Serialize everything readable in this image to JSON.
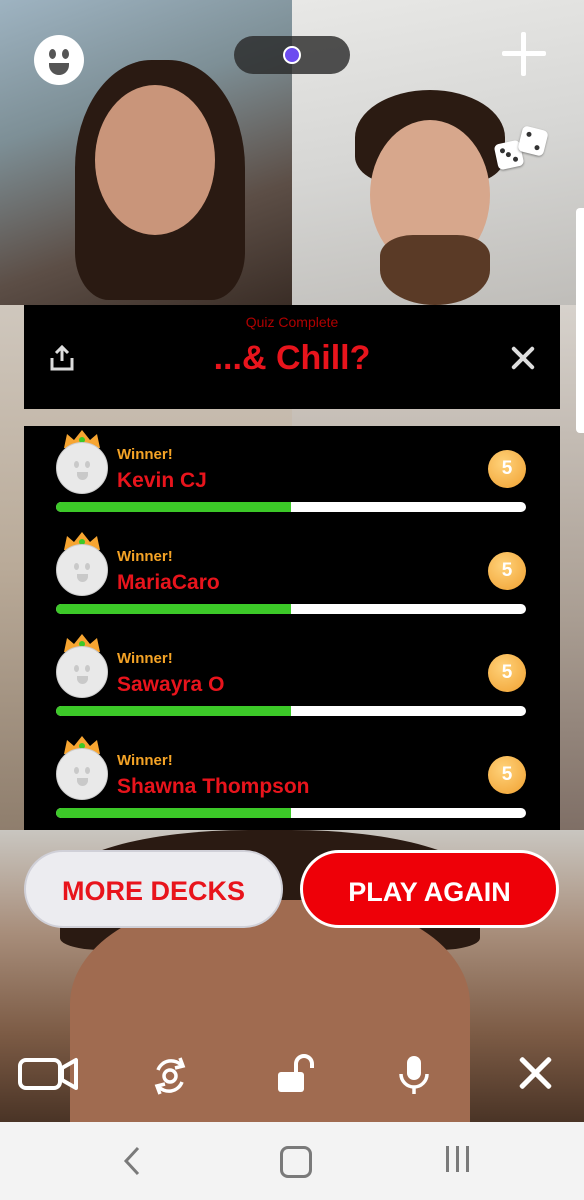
{
  "quiz": {
    "status": "Quiz Complete",
    "title": "...& Chill?"
  },
  "players": [
    {
      "badge": "Winner!",
      "name": "Kevin CJ",
      "score": "5",
      "progress": 0.5
    },
    {
      "badge": "Winner!",
      "name": "MariaCaro",
      "score": "5",
      "progress": 0.5
    },
    {
      "badge": "Winner!",
      "name": "Sawayra O",
      "score": "5",
      "progress": 0.5
    },
    {
      "badge": "Winner!",
      "name": "Shawna Thompson",
      "score": "5",
      "progress": 0.5
    }
  ],
  "actions": {
    "more_decks": "MORE DECKS",
    "play_again": "PLAY AGAIN"
  },
  "colors": {
    "accent_red": "#e8141c",
    "winner_orange": "#f4a326",
    "progress_green": "#3cc928",
    "panel_bg": "#000000"
  },
  "icons": {
    "top_left": "smiley-face-icon",
    "top_center": "record-indicator-icon",
    "top_right": "plus-icon",
    "dice": "dice-icon",
    "share": "share-icon",
    "close": "close-icon",
    "toolbar": [
      "video-camera-icon",
      "flip-camera-icon",
      "unlock-icon",
      "microphone-icon",
      "close-icon"
    ],
    "nav": [
      "back-icon",
      "home-icon",
      "recent-apps-icon"
    ]
  }
}
